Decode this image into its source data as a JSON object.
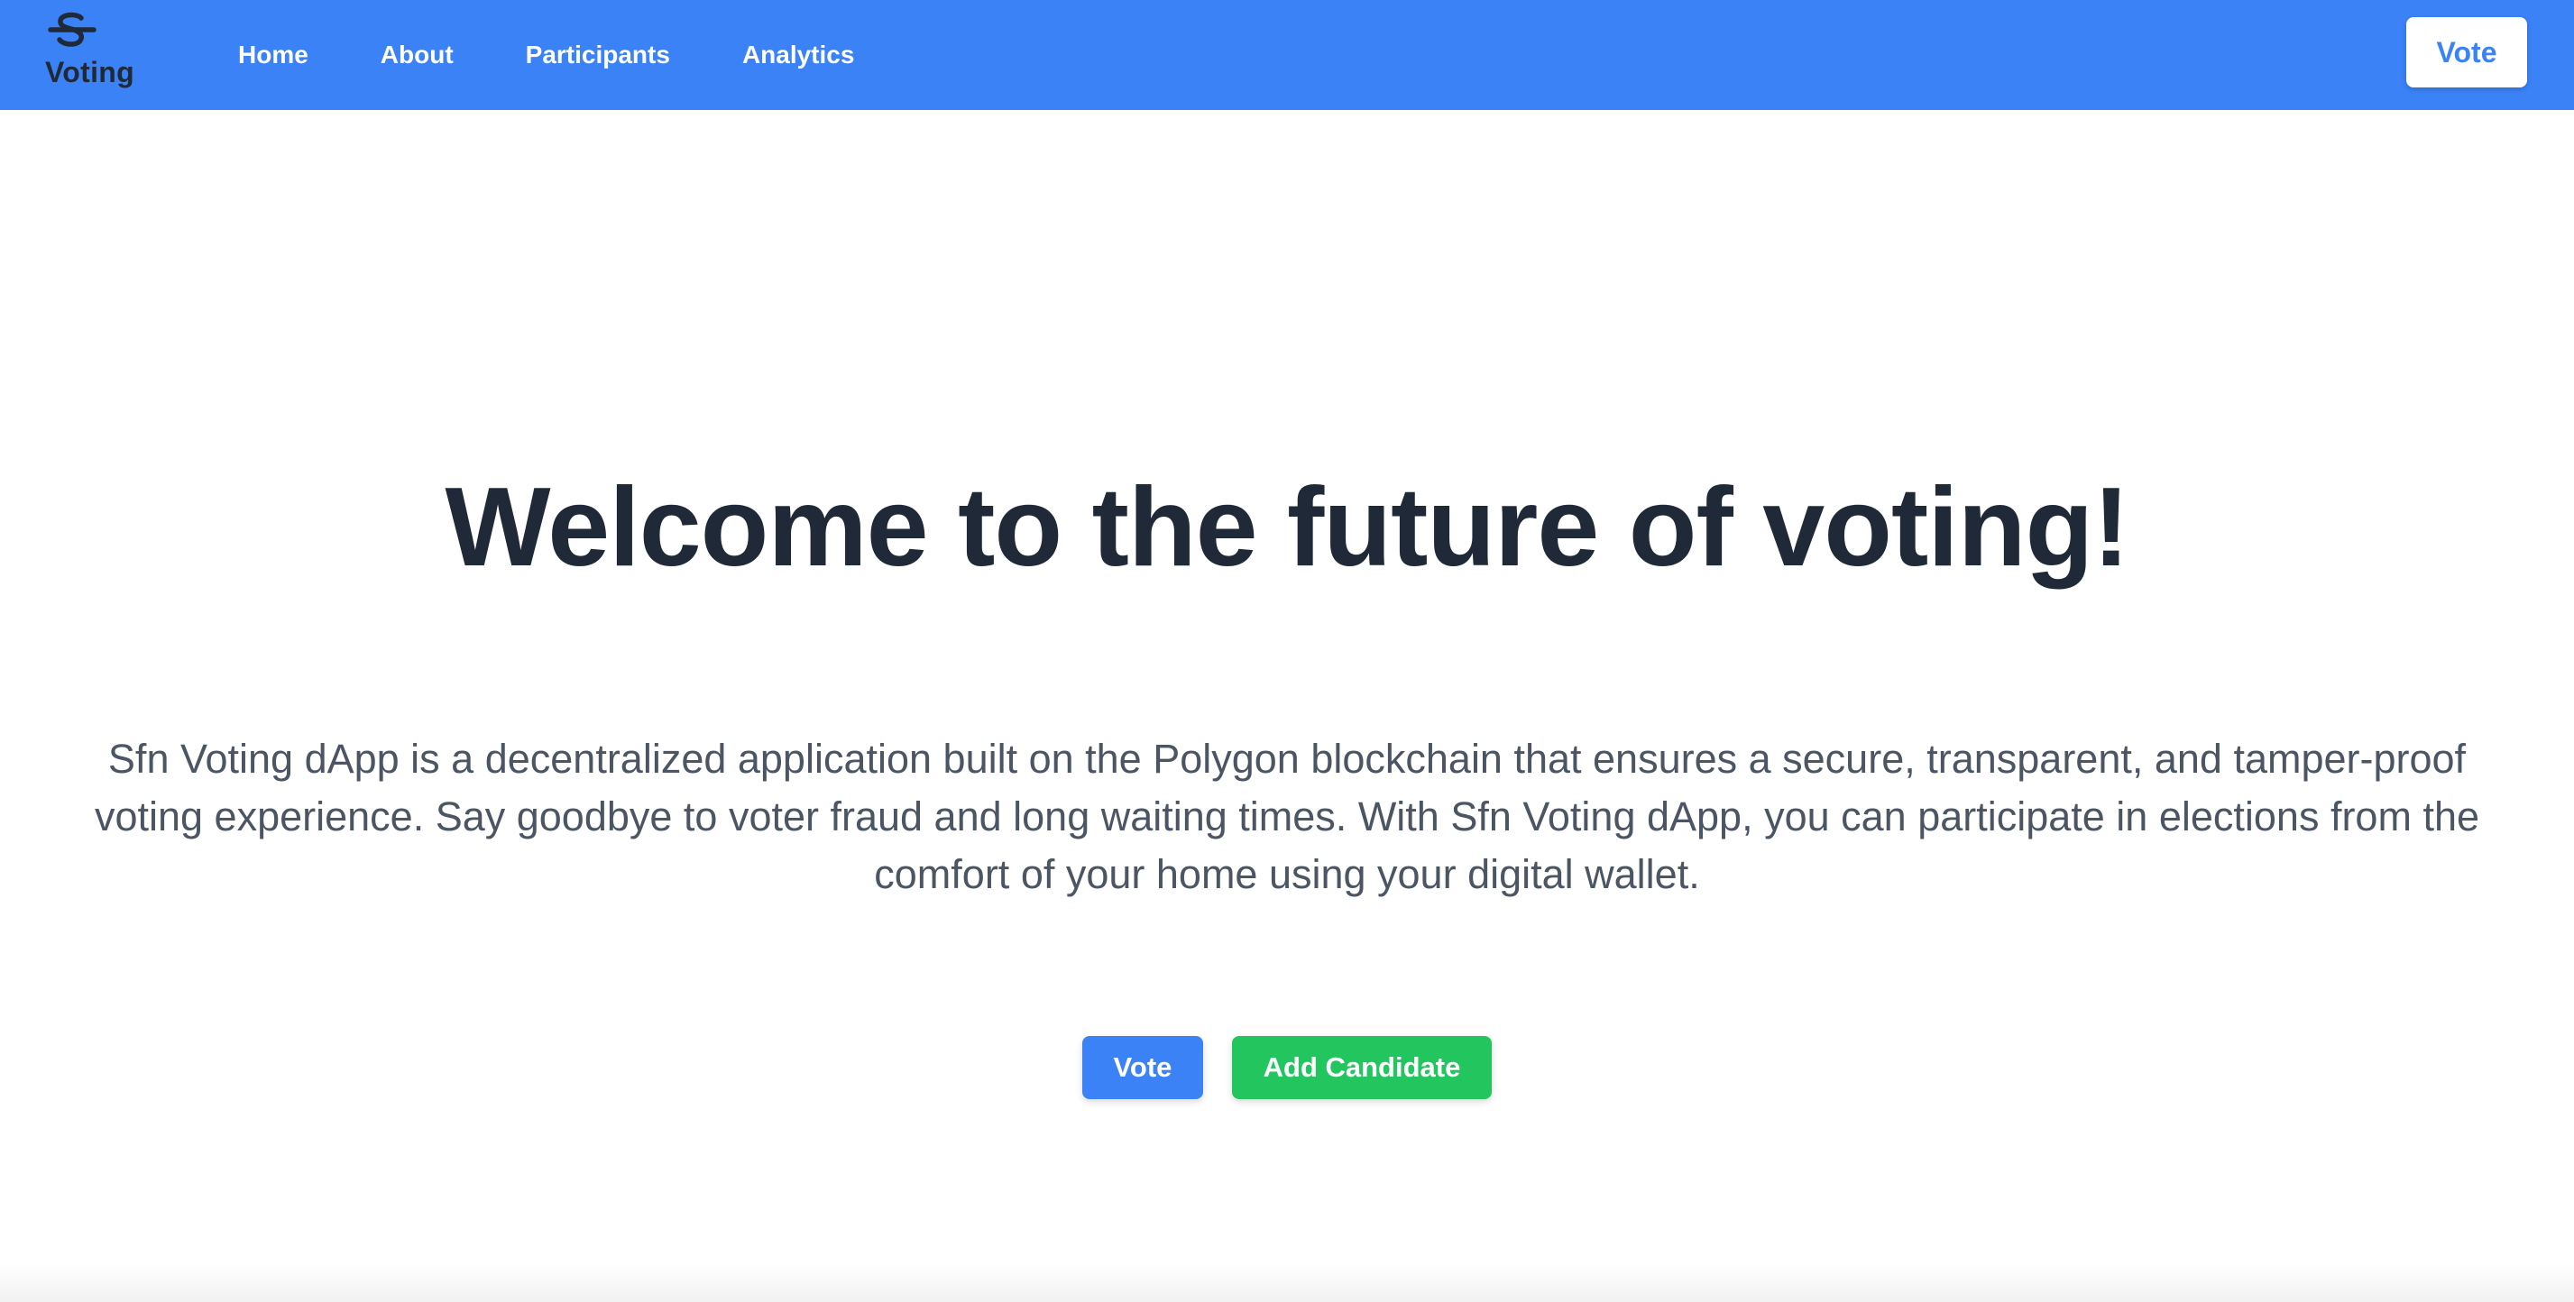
{
  "navbar": {
    "brand": {
      "icon": "s-strikethrough-logo-icon",
      "name": "Voting"
    },
    "links": [
      {
        "label": "Home"
      },
      {
        "label": "About"
      },
      {
        "label": "Participants"
      },
      {
        "label": "Analytics"
      }
    ],
    "vote_button": "Vote"
  },
  "hero": {
    "title": "Welcome to the future of voting!",
    "description": "Sfn Voting dApp is a decentralized application built on the Polygon blockchain that ensures a secure, transparent, and tamper-proof voting experience. Say goodbye to voter fraud and long waiting times. With Sfn Voting dApp, you can participate in elections from the comfort of your home using your digital wallet.",
    "primary_button": "Vote",
    "secondary_button": "Add Candidate"
  },
  "colors": {
    "navbar_bg": "#3b82f6",
    "primary": "#3b82f6",
    "success": "#22c55e",
    "heading": "#1f2937",
    "body_text": "#4b5563"
  }
}
